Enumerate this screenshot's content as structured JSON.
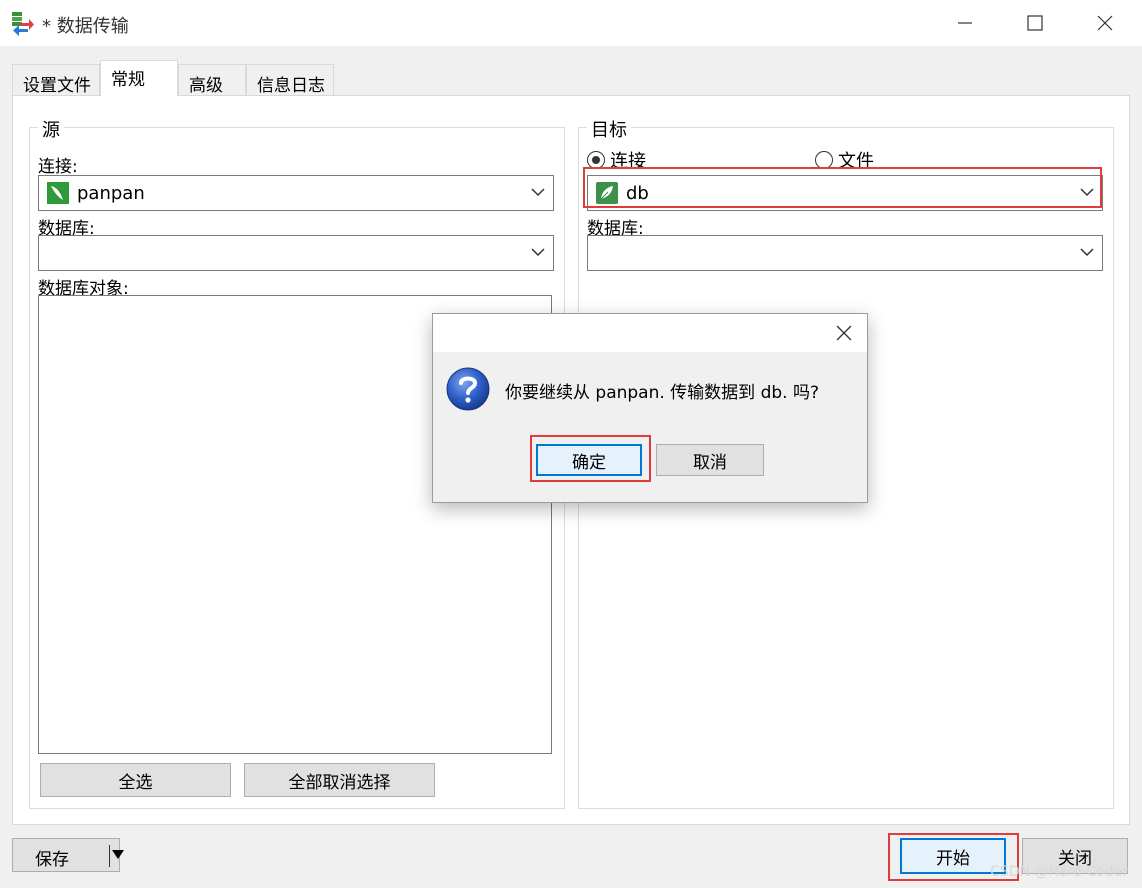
{
  "window": {
    "title": "* 数据传输",
    "controls": [
      "minimize-icon",
      "maximize-icon",
      "close-icon"
    ]
  },
  "tabs": [
    {
      "label": "设置文件",
      "active": false
    },
    {
      "label": "常规",
      "active": true
    },
    {
      "label": "高级",
      "active": false
    },
    {
      "label": "信息日志",
      "active": false
    }
  ],
  "source": {
    "group_title": "源",
    "connection_label": "连接:",
    "connection_value": "panpan",
    "connection_icon": "mysql-leaf-icon",
    "database_label": "数据库:",
    "database_value": "",
    "objects_label": "数据库对象:",
    "select_all_label": "全选",
    "deselect_all_label": "全部取消选择"
  },
  "target": {
    "group_title": "目标",
    "radio_connection_label": "连接",
    "radio_file_label": "文件",
    "selected_radio": "连接",
    "connection_value": "db",
    "connection_icon": "mongodb-leaf-icon",
    "database_label": "数据库:",
    "database_value": ""
  },
  "dialog": {
    "message": "你要继续从 panpan. 传输数据到 db. 吗?",
    "ok_label": "确定",
    "cancel_label": "取消",
    "icon": "question-icon"
  },
  "footer": {
    "save_label": "保存",
    "start_label": "开始",
    "close_label": "关闭"
  },
  "watermark": "CSDN @Hard Coder",
  "colors": {
    "highlight_red": "#e03c3c",
    "default_button_border": "#0078d7",
    "mysql_green": "#2e9a3a",
    "mongodb_green": "#3e8f4b"
  }
}
